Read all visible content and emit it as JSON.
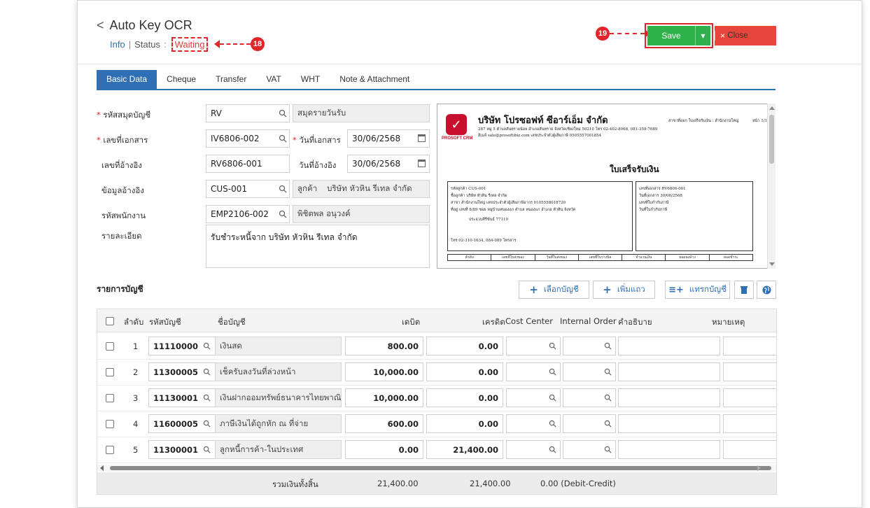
{
  "header": {
    "title": "Auto Key OCR",
    "info_link": "Info",
    "separator": "|",
    "status_label": "Status",
    "status_colon": ":",
    "status_value": "Waiting",
    "callout_status": "18",
    "callout_save": "19"
  },
  "toolbar": {
    "save_label": "Save",
    "close_label": "Close",
    "close_x": "×"
  },
  "tabs": [
    {
      "label": "Basic Data",
      "active": true
    },
    {
      "label": "Cheque"
    },
    {
      "label": "Transfer"
    },
    {
      "label": "VAT"
    },
    {
      "label": "WHT"
    },
    {
      "label": "Note & Attachment"
    }
  ],
  "form": {
    "book_label": "รหัสสมุดบัญชี",
    "book_code": "RV",
    "book_name": "สมุดรายวันรับ",
    "doc_no_label": "เลขที่เอกสาร",
    "doc_no": "IV6806-002",
    "doc_date_label": "วันที่เอกสาร",
    "doc_date": "30/06/2568",
    "ref_no_label": "เลขที่อ้างอิง",
    "ref_no": "RV6806-001",
    "ref_date_label": "วันที่อ้างอิง",
    "ref_date": "30/06/2568",
    "ref_data_label": "ข้อมูลอ้างอิง",
    "ref_data": "CUS-001",
    "customer_label": "ลูกค้า",
    "customer_name": "บริษัท หัวหิน รีเทล จำกัด",
    "employee_label": "รหัสพนักงาน",
    "employee_code": "EMP2106-002",
    "employee_name": "พิชิตพล อนุวงค์",
    "detail_label": "รายละเอียด",
    "detail": "รับชำระหนี้จาก บริษัท หัวหิน รีเทล จำกัด"
  },
  "preview": {
    "logo_text": "PROSOFT CRM",
    "company": "บริษัท โปรซอฟท์ ซีอาร์เอ็ม จำกัด",
    "branch": "สาขาที่ออก ใบเสร็จรับเงิน : สำนักงานใหญ่",
    "page": "หน้า 1/1",
    "address": "287 หมู่ 5 ตำบลสันทรายน้อย อำเภอสันทราย จังหวัดเชียงใหม่ 50210 โทร 02-402-8068, 081-359-7689",
    "email": "อีเมล์ sale@prosoftibiz.com เลขประจำตัวผู้เสียภาษี 0505557001854",
    "heading": "ใบเสร็จรับเงิน",
    "left_lines": [
      "รหัสลูกค้า   CUS-001",
      "ชื่อลูกค้า   บริษัท หัวหิน รีเทล จำกัด",
      "สาขา   สำนักงานใหญ่   เลขประจำตัวผู้เสียภาษีอากร 0105558018720",
      "ที่อยู่   เลขที่ 8/89 ซอย หมู่บ้านหนองแก ตำบล หนองแก อำเภอ หัวหิน จังหวัด",
      "ประจวบคีรีขันธ์ 77110",
      "โทร   02-310-1634, 084-089   โทรสาร"
    ],
    "right_lines": [
      "เลขที่เอกสาร   RV6806-001",
      "วันที่เอกสาร   30/06/2568",
      "เลขที่ใบกำกับภาษี",
      "วันที่ใบกำกับภาษี"
    ],
    "table_headers": [
      "ลำดับ",
      "เลขที่ใบส่งของ",
      "วันที่ใบส่งของ",
      "เลขที่ใบวางบิล",
      "จำนวนเงิน",
      "ยอดคงค้าง",
      "ยอดชำระ"
    ]
  },
  "accounts": {
    "title": "รายการบัญชี",
    "btn_select": "เลือกบัญชี",
    "btn_add_row": "เพิ่มแถว",
    "btn_insert": "แทรกบัญชี",
    "columns": {
      "no": "ลำดับ",
      "code": "รหัสบัญชี",
      "name": "ชื่อบัญชี",
      "debit": "เดบิต",
      "credit": "เครดิต",
      "cost_center": "Cost Center",
      "internal_order": "Internal Order",
      "description": "คำอธิบาย",
      "remark": "หมายเหตุ"
    },
    "rows": [
      {
        "no": "1",
        "code": "11110000",
        "name": "เงินสด",
        "debit": "800.00",
        "credit": "0.00"
      },
      {
        "no": "2",
        "code": "11300005",
        "name": "เช็ครับลงวันที่ล่วงหน้า",
        "debit": "10,000.00",
        "credit": "0.00"
      },
      {
        "no": "3",
        "code": "11130001",
        "name": "เงินฝากออมทรัพย์ธนาคารไทยพาณิ",
        "debit": "10,000.00",
        "credit": "0.00"
      },
      {
        "no": "4",
        "code": "11600005",
        "name": "ภาษีเงินได้ถูกหัก ณ ที่จ่าย",
        "debit": "600.00",
        "credit": "0.00"
      },
      {
        "no": "5",
        "code": "11300001",
        "name": "ลูกหนี้การค้า-ในประเทศ",
        "debit": "0.00",
        "credit": "21,400.00"
      }
    ],
    "footer": {
      "total_label": "รวมเงินทั้งสิ้น",
      "total_debit": "21,400.00",
      "total_credit": "21,400.00",
      "difference": "0.00 (Debit-Credit)"
    }
  },
  "colors": {
    "primary": "#2f6fb3",
    "save": "#2fb24c",
    "close": "#e8453c",
    "callout": "#e0262a"
  }
}
